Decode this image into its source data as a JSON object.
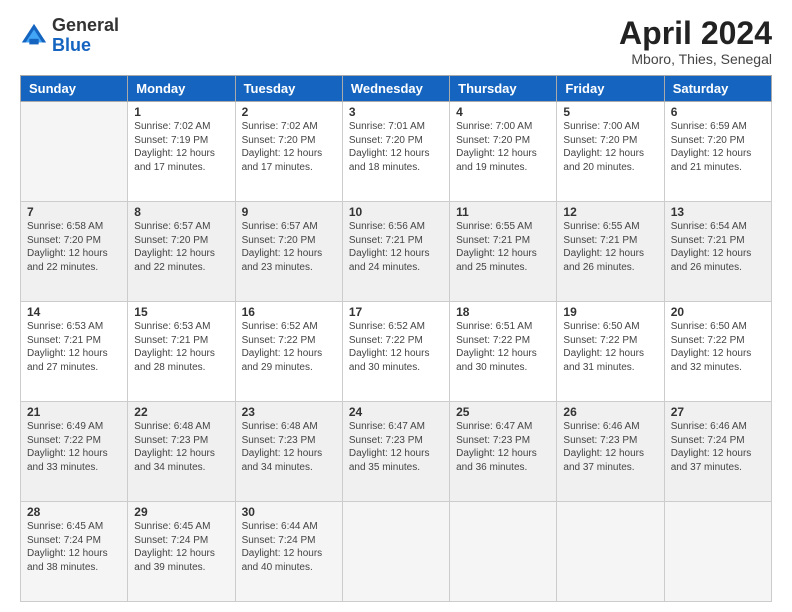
{
  "header": {
    "logo_general": "General",
    "logo_blue": "Blue",
    "month_title": "April 2024",
    "location": "Mboro, Thies, Senegal"
  },
  "days_of_week": [
    "Sunday",
    "Monday",
    "Tuesday",
    "Wednesday",
    "Thursday",
    "Friday",
    "Saturday"
  ],
  "weeks": [
    [
      {
        "day": "",
        "sunrise": "",
        "sunset": "",
        "daylight": ""
      },
      {
        "day": "1",
        "sunrise": "Sunrise: 7:02 AM",
        "sunset": "Sunset: 7:19 PM",
        "daylight": "Daylight: 12 hours and 17 minutes."
      },
      {
        "day": "2",
        "sunrise": "Sunrise: 7:02 AM",
        "sunset": "Sunset: 7:20 PM",
        "daylight": "Daylight: 12 hours and 17 minutes."
      },
      {
        "day": "3",
        "sunrise": "Sunrise: 7:01 AM",
        "sunset": "Sunset: 7:20 PM",
        "daylight": "Daylight: 12 hours and 18 minutes."
      },
      {
        "day": "4",
        "sunrise": "Sunrise: 7:00 AM",
        "sunset": "Sunset: 7:20 PM",
        "daylight": "Daylight: 12 hours and 19 minutes."
      },
      {
        "day": "5",
        "sunrise": "Sunrise: 7:00 AM",
        "sunset": "Sunset: 7:20 PM",
        "daylight": "Daylight: 12 hours and 20 minutes."
      },
      {
        "day": "6",
        "sunrise": "Sunrise: 6:59 AM",
        "sunset": "Sunset: 7:20 PM",
        "daylight": "Daylight: 12 hours and 21 minutes."
      }
    ],
    [
      {
        "day": "7",
        "sunrise": "Sunrise: 6:58 AM",
        "sunset": "Sunset: 7:20 PM",
        "daylight": "Daylight: 12 hours and 22 minutes."
      },
      {
        "day": "8",
        "sunrise": "Sunrise: 6:57 AM",
        "sunset": "Sunset: 7:20 PM",
        "daylight": "Daylight: 12 hours and 22 minutes."
      },
      {
        "day": "9",
        "sunrise": "Sunrise: 6:57 AM",
        "sunset": "Sunset: 7:20 PM",
        "daylight": "Daylight: 12 hours and 23 minutes."
      },
      {
        "day": "10",
        "sunrise": "Sunrise: 6:56 AM",
        "sunset": "Sunset: 7:21 PM",
        "daylight": "Daylight: 12 hours and 24 minutes."
      },
      {
        "day": "11",
        "sunrise": "Sunrise: 6:55 AM",
        "sunset": "Sunset: 7:21 PM",
        "daylight": "Daylight: 12 hours and 25 minutes."
      },
      {
        "day": "12",
        "sunrise": "Sunrise: 6:55 AM",
        "sunset": "Sunset: 7:21 PM",
        "daylight": "Daylight: 12 hours and 26 minutes."
      },
      {
        "day": "13",
        "sunrise": "Sunrise: 6:54 AM",
        "sunset": "Sunset: 7:21 PM",
        "daylight": "Daylight: 12 hours and 26 minutes."
      }
    ],
    [
      {
        "day": "14",
        "sunrise": "Sunrise: 6:53 AM",
        "sunset": "Sunset: 7:21 PM",
        "daylight": "Daylight: 12 hours and 27 minutes."
      },
      {
        "day": "15",
        "sunrise": "Sunrise: 6:53 AM",
        "sunset": "Sunset: 7:21 PM",
        "daylight": "Daylight: 12 hours and 28 minutes."
      },
      {
        "day": "16",
        "sunrise": "Sunrise: 6:52 AM",
        "sunset": "Sunset: 7:22 PM",
        "daylight": "Daylight: 12 hours and 29 minutes."
      },
      {
        "day": "17",
        "sunrise": "Sunrise: 6:52 AM",
        "sunset": "Sunset: 7:22 PM",
        "daylight": "Daylight: 12 hours and 30 minutes."
      },
      {
        "day": "18",
        "sunrise": "Sunrise: 6:51 AM",
        "sunset": "Sunset: 7:22 PM",
        "daylight": "Daylight: 12 hours and 30 minutes."
      },
      {
        "day": "19",
        "sunrise": "Sunrise: 6:50 AM",
        "sunset": "Sunset: 7:22 PM",
        "daylight": "Daylight: 12 hours and 31 minutes."
      },
      {
        "day": "20",
        "sunrise": "Sunrise: 6:50 AM",
        "sunset": "Sunset: 7:22 PM",
        "daylight": "Daylight: 12 hours and 32 minutes."
      }
    ],
    [
      {
        "day": "21",
        "sunrise": "Sunrise: 6:49 AM",
        "sunset": "Sunset: 7:22 PM",
        "daylight": "Daylight: 12 hours and 33 minutes."
      },
      {
        "day": "22",
        "sunrise": "Sunrise: 6:48 AM",
        "sunset": "Sunset: 7:23 PM",
        "daylight": "Daylight: 12 hours and 34 minutes."
      },
      {
        "day": "23",
        "sunrise": "Sunrise: 6:48 AM",
        "sunset": "Sunset: 7:23 PM",
        "daylight": "Daylight: 12 hours and 34 minutes."
      },
      {
        "day": "24",
        "sunrise": "Sunrise: 6:47 AM",
        "sunset": "Sunset: 7:23 PM",
        "daylight": "Daylight: 12 hours and 35 minutes."
      },
      {
        "day": "25",
        "sunrise": "Sunrise: 6:47 AM",
        "sunset": "Sunset: 7:23 PM",
        "daylight": "Daylight: 12 hours and 36 minutes."
      },
      {
        "day": "26",
        "sunrise": "Sunrise: 6:46 AM",
        "sunset": "Sunset: 7:23 PM",
        "daylight": "Daylight: 12 hours and 37 minutes."
      },
      {
        "day": "27",
        "sunrise": "Sunrise: 6:46 AM",
        "sunset": "Sunset: 7:24 PM",
        "daylight": "Daylight: 12 hours and 37 minutes."
      }
    ],
    [
      {
        "day": "28",
        "sunrise": "Sunrise: 6:45 AM",
        "sunset": "Sunset: 7:24 PM",
        "daylight": "Daylight: 12 hours and 38 minutes."
      },
      {
        "day": "29",
        "sunrise": "Sunrise: 6:45 AM",
        "sunset": "Sunset: 7:24 PM",
        "daylight": "Daylight: 12 hours and 39 minutes."
      },
      {
        "day": "30",
        "sunrise": "Sunrise: 6:44 AM",
        "sunset": "Sunset: 7:24 PM",
        "daylight": "Daylight: 12 hours and 40 minutes."
      },
      {
        "day": "",
        "sunrise": "",
        "sunset": "",
        "daylight": ""
      },
      {
        "day": "",
        "sunrise": "",
        "sunset": "",
        "daylight": ""
      },
      {
        "day": "",
        "sunrise": "",
        "sunset": "",
        "daylight": ""
      },
      {
        "day": "",
        "sunrise": "",
        "sunset": "",
        "daylight": ""
      }
    ]
  ]
}
